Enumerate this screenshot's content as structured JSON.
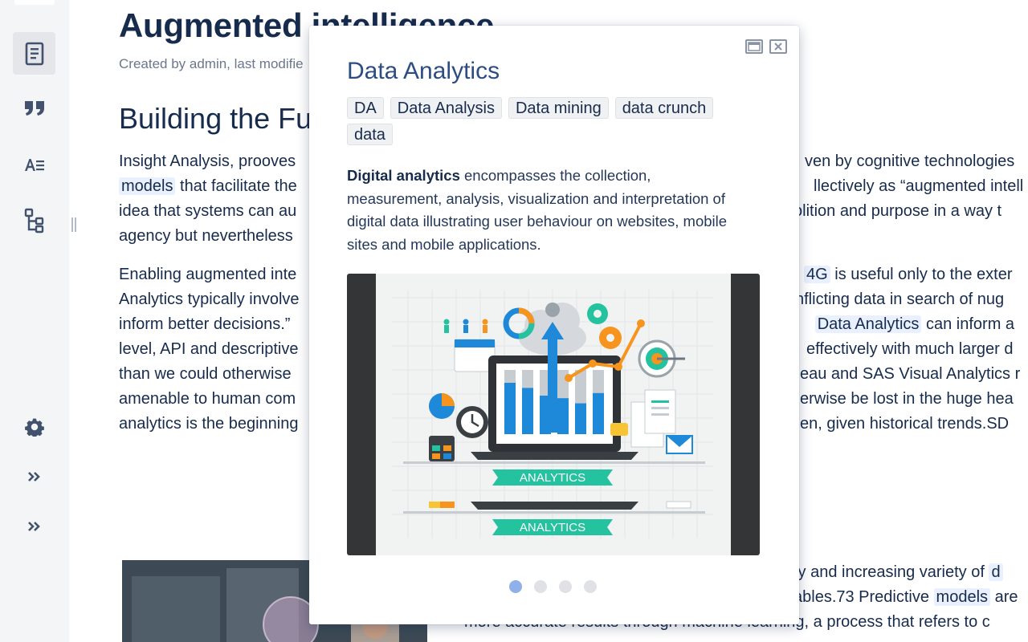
{
  "sidebar": {
    "items": [
      {
        "icon": "page-icon"
      },
      {
        "icon": "quote-icon"
      },
      {
        "icon": "text-format-icon"
      },
      {
        "icon": "hierarchy-icon"
      },
      {
        "icon": "gear-icon"
      },
      {
        "icon": "expand-icon"
      },
      {
        "icon": "expand-icon"
      }
    ]
  },
  "page": {
    "title": "Augmented intelligence",
    "byline": "Created by admin, last modifie",
    "heading": "Building the Fu"
  },
  "para1": {
    "l1a": "Insight Analysis,  prooves",
    "l1b": "ven by cognitive technologies",
    "l2a": "models",
    "l2b": " that facilitate the",
    "l2c": "llectively as “augmented intell",
    "l3a": "idea that systems can au",
    "l3b": "olition and purpose in a way t",
    "l4a": "agency but nevertheless"
  },
  "para2": {
    "l1a": "Enabling augmented inte",
    "l1hl": "4G",
    "l1b": " is useful only to the exter",
    "l2a": "Analytics typically involve",
    "l2b": "nflicting data  in search of nug",
    "l3a": "inform better decisions.”",
    "l3dot": ".",
    "l3hl": "Data Analytics",
    "l3b": " can inform a",
    "l4a": "level, API and descriptive",
    "l4b": "effectively with much larger d",
    "l5a": "than we could otherwise",
    "l5b": "eau and SAS Visual Analytics r",
    "l6a": "amenable to human com",
    "l6b": "erwise be lost in the huge hea",
    "l7a": "analytics is the beginning",
    "l7b": "en, given historical trends.SD"
  },
  "para3": {
    "l1a": "ty and increasing variety of ",
    "l1hl": "d",
    "l2a": "ables.73 Predictive ",
    "l2hl": "models",
    "l2b": " are",
    "l3a": "more accurate results through machine learning, a process that refers to c"
  },
  "popup": {
    "title": "Data Analytics",
    "tags": [
      "DA",
      "Data Analysis",
      "Data mining",
      "data crunch",
      "data"
    ],
    "desc_bold": "Digital analytics",
    "desc_rest": " encompasses the collection, measurement, analysis, visualization and interpretation of digital data illustrating user behaviour on websites, mobile sites and mobile applications.",
    "image": {
      "banner_text_1": "ANALYTICS",
      "banner_text_2": "ANALYTICS",
      "bar_values": [
        0.8,
        0.72,
        0.6,
        0.56,
        0.48,
        0.64
      ],
      "bar_color": "#1e88d9",
      "accent_teal": "#25c2a0",
      "accent_orange": "#f7941d"
    },
    "dots": {
      "count": 4,
      "active_index": 0
    }
  },
  "colors": {
    "highlight": "#e9f0ff",
    "title": "#2d4d80",
    "sidebar_bg": "#f4f5f7"
  }
}
